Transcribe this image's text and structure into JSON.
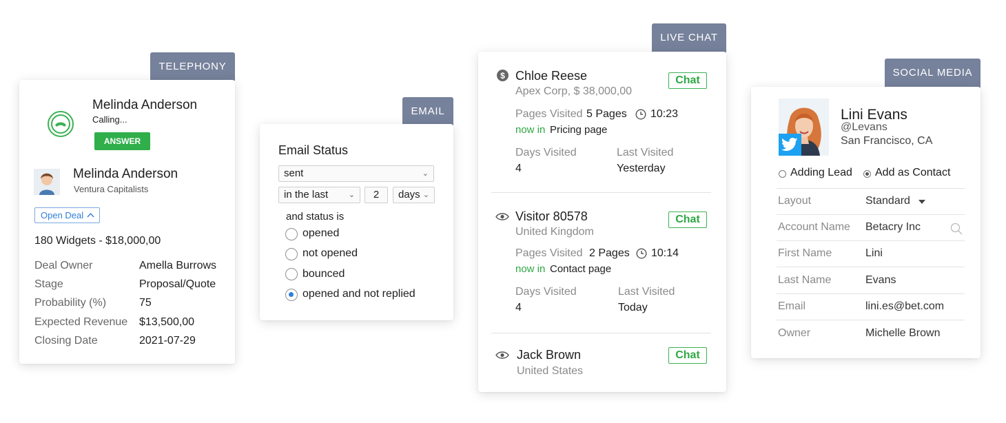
{
  "telephony": {
    "tag": "TELEPHONY",
    "caller_name": "Melinda Anderson",
    "call_status": "Calling...",
    "answer_label": "ANSWER",
    "contact_name": "Melinda Anderson",
    "company": "Ventura Capitalists",
    "open_deal_label": "Open Deal",
    "deal_summary": "180 Widgets - $18,000,00",
    "fields": [
      {
        "label": "Deal Owner",
        "value": "Amella Burrows"
      },
      {
        "label": "Stage",
        "value": "Proposal/Quote"
      },
      {
        "label": "Probability (%)",
        "value": "75"
      },
      {
        "label": "Expected Revenue",
        "value": "$13,500,00"
      },
      {
        "label": "Closing Date",
        "value": "2021-07-29"
      }
    ]
  },
  "email": {
    "tag": "EMAIL",
    "title": "Email Status",
    "status_select": "sent",
    "range_select": "in the last",
    "range_number": "2",
    "unit_select": "days",
    "status_label": "and status is",
    "options": [
      "opened",
      "not opened",
      "bounced",
      "opened and not replied"
    ],
    "selected_option": "opened and not replied"
  },
  "live_chat": {
    "tag": "LIVE CHAT",
    "chat_label": "Chat",
    "visitors": [
      {
        "name": "Chloe Reese",
        "subtitle": "Apex Corp, $ 38,000,00",
        "pages_label": "Pages Visited",
        "pages_value": "5 Pages",
        "time": "10:23",
        "now_in_label": "now in",
        "now_in_page": "Pricing page",
        "days_label": "Days Visited",
        "days_value": "4",
        "last_label": "Last Visited",
        "last_value": "Yesterday"
      },
      {
        "name": "Visitor 80578",
        "subtitle": "United Kingdom",
        "pages_label": "Pages Visited",
        "pages_value": "2 Pages",
        "time": "10:14",
        "now_in_label": "now in",
        "now_in_page": "Contact page",
        "days_label": "Days Visited",
        "days_value": "4",
        "last_label": "Last Visited",
        "last_value": "Today"
      },
      {
        "name": "Jack Brown",
        "subtitle": "United States"
      }
    ]
  },
  "social": {
    "tag": "SOCIAL MEDIA",
    "name": "Lini Evans",
    "handle": "@Levans",
    "location": "San Francisco, CA",
    "radio_adding_lead": "Adding Lead",
    "radio_add_contact": "Add as Contact",
    "layout_label": "Layout",
    "layout_value": "Standard",
    "fields": [
      {
        "label": "Account Name",
        "value": "Betacry Inc"
      },
      {
        "label": "First Name",
        "value": "Lini"
      },
      {
        "label": "Last Name",
        "value": "Evans"
      },
      {
        "label": "Email",
        "value": "lini.es@bet.com"
      },
      {
        "label": "Owner",
        "value": "Michelle Brown"
      }
    ]
  },
  "colors": {
    "tag_bg": "#76819b",
    "accent_green": "#2ea843",
    "link_blue": "#2f7fd8",
    "twitter_blue": "#1da1f2"
  },
  "icons": [
    "phone-ring-icon",
    "chevron-up-icon",
    "chevron-down-icon",
    "dollar-icon",
    "clock-icon",
    "eye-icon",
    "search-icon",
    "twitter-icon",
    "caret-down-icon"
  ]
}
